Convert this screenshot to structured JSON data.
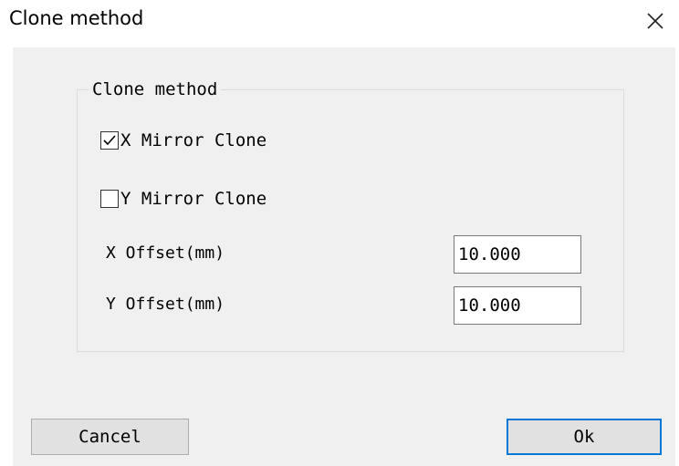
{
  "window": {
    "title": "Clone method",
    "close_icon": "close-icon"
  },
  "group": {
    "title": "Clone method"
  },
  "options": {
    "x_mirror": {
      "label": "X Mirror Clone",
      "checked": true
    },
    "y_mirror": {
      "label": "Y Mirror Clone",
      "checked": false
    }
  },
  "fields": {
    "x_offset": {
      "label": "X Offset(mm)",
      "value": "10.000"
    },
    "y_offset": {
      "label": "Y Offset(mm)",
      "value": "10.000"
    }
  },
  "buttons": {
    "cancel": "Cancel",
    "ok": "Ok"
  },
  "colors": {
    "client_bg": "#f0f0f0",
    "default_button_border": "#0078d7"
  }
}
